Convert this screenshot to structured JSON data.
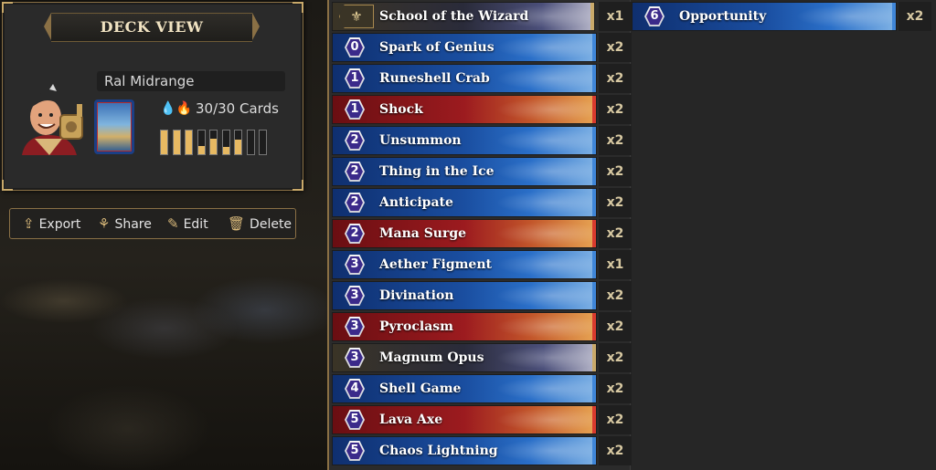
{
  "deck": {
    "header": "DECK VIEW",
    "name": "Ral Midrange",
    "card_count": "30/30 Cards",
    "colors": {
      "blue": "#3c8fe0",
      "red": "#d8402e",
      "accent": "#c9a96a"
    },
    "mana_curve_fill": [
      1.0,
      1.0,
      1.0,
      0.35,
      0.65,
      0.3,
      0.6,
      0.0,
      0.0
    ]
  },
  "actions": {
    "export": "Export",
    "share": "Share",
    "edit": "Edit",
    "delete": "Delete"
  },
  "cards": [
    {
      "cost": "",
      "name": "School of the Wizard",
      "qty": "x1",
      "color": "multi",
      "symbol": "⚜"
    },
    {
      "cost": "0",
      "name": "Spark of Genius",
      "qty": "x2",
      "color": "blue"
    },
    {
      "cost": "1",
      "name": "Runeshell Crab",
      "qty": "x2",
      "color": "blue"
    },
    {
      "cost": "1",
      "name": "Shock",
      "qty": "x2",
      "color": "red"
    },
    {
      "cost": "2",
      "name": "Unsummon",
      "qty": "x2",
      "color": "blue"
    },
    {
      "cost": "2",
      "name": "Thing in the Ice",
      "qty": "x2",
      "color": "blue"
    },
    {
      "cost": "2",
      "name": "Anticipate",
      "qty": "x2",
      "color": "blue"
    },
    {
      "cost": "2",
      "name": "Mana Surge",
      "qty": "x2",
      "color": "red"
    },
    {
      "cost": "3",
      "name": "Aether Figment",
      "qty": "x1",
      "color": "blue"
    },
    {
      "cost": "3",
      "name": "Divination",
      "qty": "x2",
      "color": "blue"
    },
    {
      "cost": "3",
      "name": "Pyroclasm",
      "qty": "x2",
      "color": "red"
    },
    {
      "cost": "3",
      "name": "Magnum Opus",
      "qty": "x2",
      "color": "multi"
    },
    {
      "cost": "4",
      "name": "Shell Game",
      "qty": "x2",
      "color": "blue"
    },
    {
      "cost": "5",
      "name": "Lava Axe",
      "qty": "x2",
      "color": "red"
    },
    {
      "cost": "5",
      "name": "Chaos Lightning",
      "qty": "x2",
      "color": "blue"
    }
  ],
  "cards_col2": [
    {
      "cost": "6",
      "name": "Opportunity",
      "qty": "x2",
      "color": "blue"
    }
  ]
}
